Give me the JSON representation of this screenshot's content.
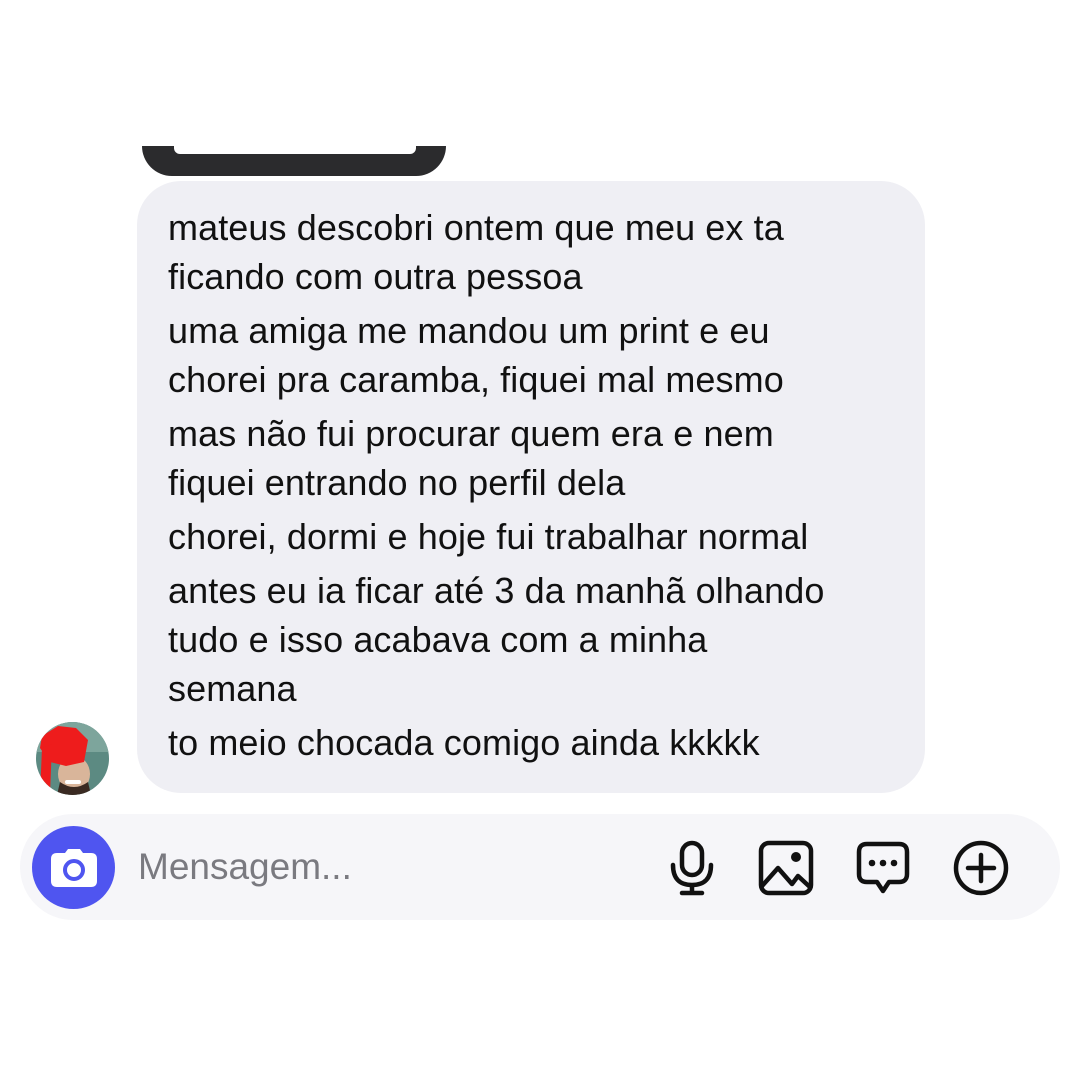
{
  "conversation": {
    "message": {
      "paragraphs": [
        {
          "lines": [
            "mateus descobri ontem que meu ex ta",
            "ficando com outra pessoa"
          ]
        },
        {
          "lines": [
            "uma amiga me mandou um print e eu",
            "chorei pra caramba, fiquei mal mesmo"
          ]
        },
        {
          "lines": [
            "mas não fui procurar quem era e nem",
            "fiquei entrando no perfil dela"
          ]
        },
        {
          "lines": [
            "chorei, dormi e hoje fui trabalhar normal"
          ]
        },
        {
          "lines": [
            "antes eu ia ficar até 3 da manhã olhando",
            "tudo e isso acabava com a minha",
            "semana"
          ]
        },
        {
          "lines": [
            "to meio chocada comigo ainda kkkkk"
          ]
        }
      ]
    }
  },
  "composer": {
    "placeholder": "Mensagem...",
    "icons": {
      "camera": "camera-icon",
      "mic": "microphone-icon",
      "gallery": "gallery-icon",
      "sticker": "chat-bubble-icon",
      "add": "plus-circle-icon"
    }
  },
  "colors": {
    "bubble": "#efeff4",
    "accent": "#4f55f0",
    "composer": "#f6f6f9"
  }
}
